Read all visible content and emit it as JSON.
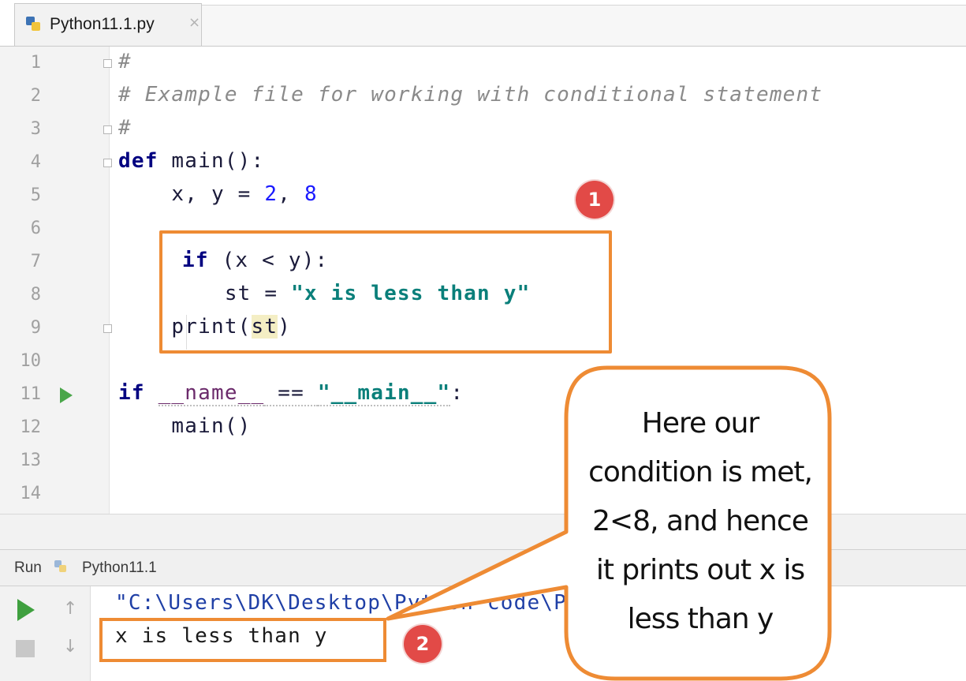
{
  "tab": {
    "filename": "Python11.1.py",
    "close_glyph": "×"
  },
  "editor": {
    "line_numbers": [
      "1",
      "2",
      "3",
      "4",
      "5",
      "6",
      "7",
      "8",
      "9",
      "10",
      "11",
      "12",
      "13",
      "14"
    ],
    "code": {
      "l1": "#",
      "l2": "# Example file for working with conditional statement",
      "l3": "#",
      "l4_kw": "def",
      "l4_rest": " main():",
      "l5_a": "    x, y = ",
      "l5_n1": "2",
      "l5_b": ", ",
      "l5_n2": "8",
      "l7_kw": "if",
      "l7_rest": " (x < y):",
      "l8_a": "        st = ",
      "l8_str": "\"x is less than y\"",
      "l9_a": "    print(",
      "l9_hl": "st",
      "l9_b": ")",
      "l11_kw": "if",
      "l11_sp": " ",
      "l11_name": "__name__",
      "l11_eq": " == ",
      "l11_str": "\"__main__\"",
      "l11_colon": ":",
      "l12": "    main()"
    }
  },
  "run_panel": {
    "title": "Run",
    "config": "Python11.1",
    "command": "\"C:\\Users\\DK\\Desktop\\Python code\\Python 11",
    "output": "x is less than y"
  },
  "annotations": {
    "badge_1": "1",
    "badge_2": "2",
    "callout_lines": [
      "Here our",
      "condition is met,",
      "2<8, and hence",
      "it prints out x is",
      "less than y"
    ],
    "accent_color": "#ee8b34",
    "badge_color": "#e24a47"
  }
}
